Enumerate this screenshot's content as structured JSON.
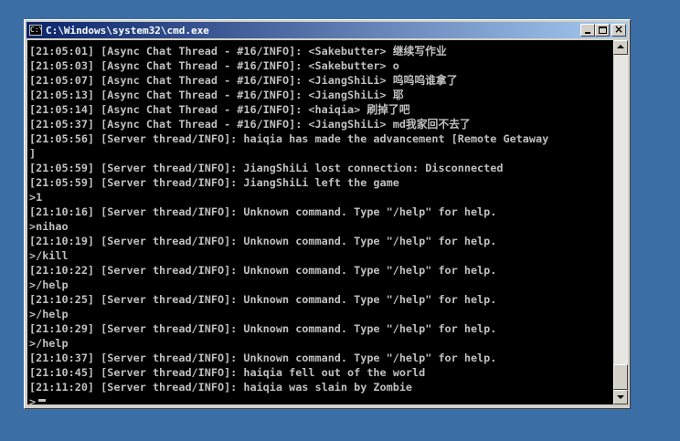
{
  "window": {
    "title": "C:\\Windows\\system32\\cmd.exe",
    "icon": "cmd-console-icon",
    "controls": {
      "minimize": "minimize-icon",
      "maximize": "maximize-icon",
      "close": "close-icon"
    }
  },
  "console": {
    "lines": [
      "[21:05:01] [Async Chat Thread - #16/INFO]: <Sakebutter> 继续写作业",
      "[21:05:03] [Async Chat Thread - #16/INFO]: <Sakebutter> o",
      "[21:05:07] [Async Chat Thread - #16/INFO]: <JiangShiLi> 呜呜呜谁拿了",
      "[21:05:13] [Async Chat Thread - #16/INFO]: <JiangShiLi> 耶",
      "[21:05:14] [Async Chat Thread - #16/INFO]: <haiqia> 刷掉了吧",
      "[21:05:37] [Async Chat Thread - #16/INFO]: <JiangShiLi> md我家回不去了",
      "[21:05:56] [Server thread/INFO]: haiqia has made the advancement [Remote Getaway",
      "]",
      "[21:05:59] [Server thread/INFO]: JiangShiLi lost connection: Disconnected",
      "[21:05:59] [Server thread/INFO]: JiangShiLi left the game",
      ">1",
      "[21:10:16] [Server thread/INFO]: Unknown command. Type \"/help\" for help.",
      ">nihao",
      "[21:10:19] [Server thread/INFO]: Unknown command. Type \"/help\" for help.",
      ">/kill",
      "[21:10:22] [Server thread/INFO]: Unknown command. Type \"/help\" for help.",
      ">/help",
      "[21:10:25] [Server thread/INFO]: Unknown command. Type \"/help\" for help.",
      ">/help",
      "[21:10:29] [Server thread/INFO]: Unknown command. Type \"/help\" for help.",
      ">/help",
      "[21:10:37] [Server thread/INFO]: Unknown command. Type \"/help\" for help.",
      "[21:10:45] [Server thread/INFO]: haiqia fell out of the world",
      "[21:11:20] [Server thread/INFO]: haiqia was slain by Zombie",
      ">"
    ]
  },
  "scrollbar": {
    "up_icon": "scroll-up-arrow-icon",
    "down_icon": "scroll-down-arrow-icon",
    "position": 0.97
  },
  "colors": {
    "desktop": "#3a6ea5",
    "title_start": "#0a246a",
    "title_end": "#a6caf0",
    "console_bg": "#000000",
    "console_text": "#c0c0c0"
  }
}
